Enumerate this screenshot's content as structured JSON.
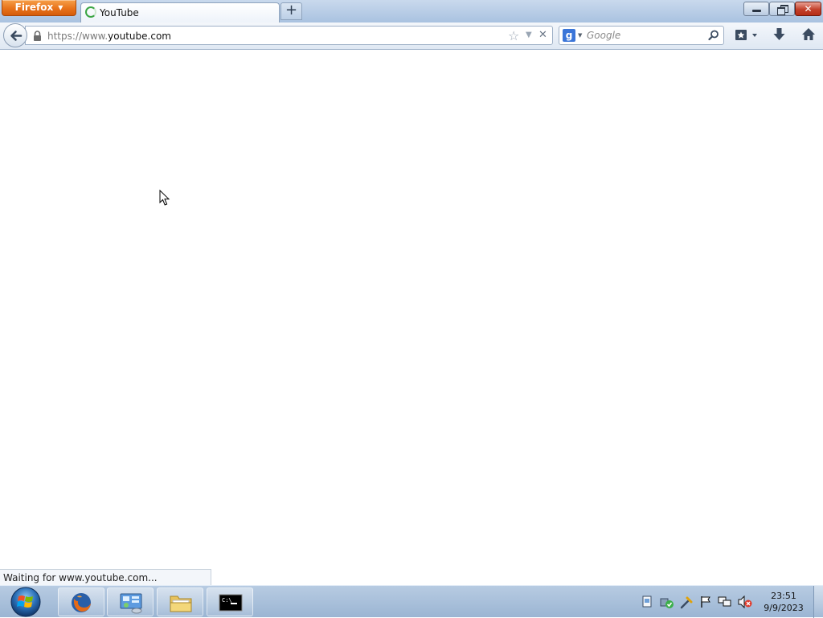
{
  "browser": {
    "menu_button_label": "Firefox",
    "tab": {
      "title": "YouTube"
    },
    "new_tab_label": "+",
    "close_label": "✕"
  },
  "urlbar": {
    "scheme_prefix": "https://www.",
    "host": "youtube.com"
  },
  "searchbar": {
    "engine_letter": "g",
    "placeholder": "Google"
  },
  "status": {
    "text": "Waiting for www.youtube.com..."
  },
  "taskbar": {
    "apps": [
      "firefox",
      "control-panel",
      "file-explorer",
      "command-prompt"
    ],
    "clock": {
      "time": "23:51",
      "date": "9/9/2023"
    }
  },
  "colors": {
    "firefox_orange": "#e8731b",
    "titlebar_blue": "#a9c2e0",
    "taskbar_blue": "#9bb5d3",
    "loading_green": "#3ba544"
  }
}
